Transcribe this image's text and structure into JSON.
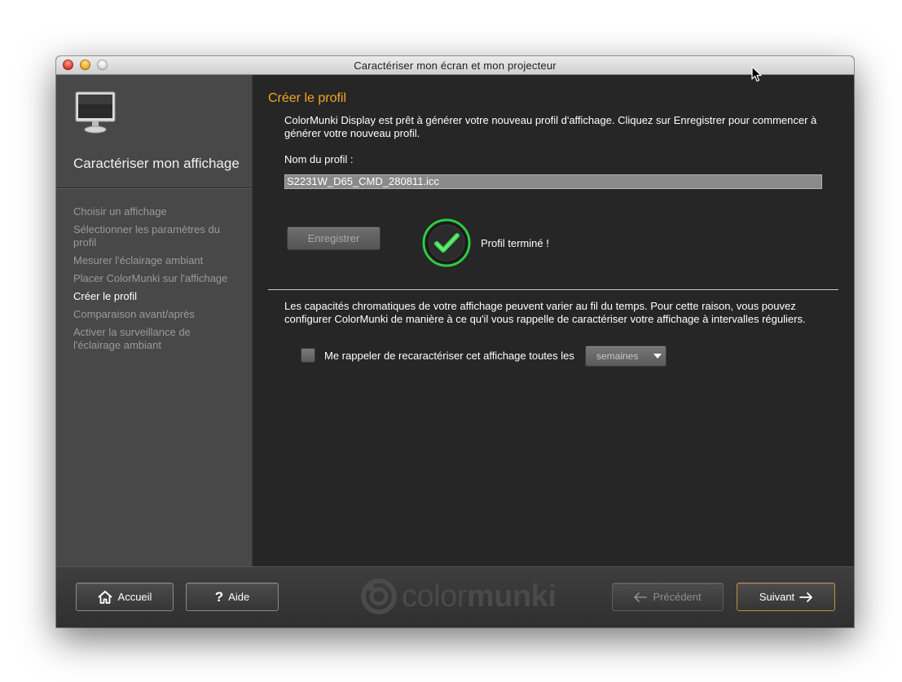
{
  "window": {
    "title": "Caractériser mon écran et mon projecteur"
  },
  "sidebar": {
    "title": "Caractériser mon affichage",
    "steps": [
      {
        "label": "Choisir un affichage",
        "active": false
      },
      {
        "label": "Sélectionner les paramètres du profil",
        "active": false
      },
      {
        "label": "Mesurer l'éclairage ambiant",
        "active": false
      },
      {
        "label": "Placer ColorMunki sur l'affichage",
        "active": false
      },
      {
        "label": "Créer le profil",
        "active": true
      },
      {
        "label": "Comparaison avant/après",
        "active": false
      },
      {
        "label": "Activer la surveillance de l'éclairage ambiant",
        "active": false
      }
    ]
  },
  "main": {
    "section_title": "Créer le profil",
    "intro": "ColorMunki Display est prêt à générer votre nouveau profil d'affichage. Cliquez sur Enregistrer pour commencer à générer votre nouveau profil.",
    "profile_name_label": "Nom du profil :",
    "profile_name_value": "S2231W_D65_CMD_280811.icc",
    "save_button": "Enregistrer",
    "status_text": "Profil terminé !",
    "capabilities_text": "Les capacités chromatiques de votre affichage peuvent varier au fil du temps. Pour cette raison, vous pouvez configurer ColorMunki de manière à ce qu'il vous rappelle de caractériser votre affichage à intervalles réguliers.",
    "reminder": {
      "label": "Me rappeler de recaractériser cet affichage toutes les",
      "checked": false,
      "interval_value": "semaines"
    }
  },
  "footer": {
    "home_button": "Accueil",
    "help_button": "Aide",
    "brand_light": "color",
    "brand_bold": "munki",
    "prev_button": "Précédent",
    "next_button": "Suivant"
  },
  "colors": {
    "accent": "#f5a623",
    "success": "#2ecc40",
    "panel": "#262626",
    "sidebar": "#484848"
  }
}
